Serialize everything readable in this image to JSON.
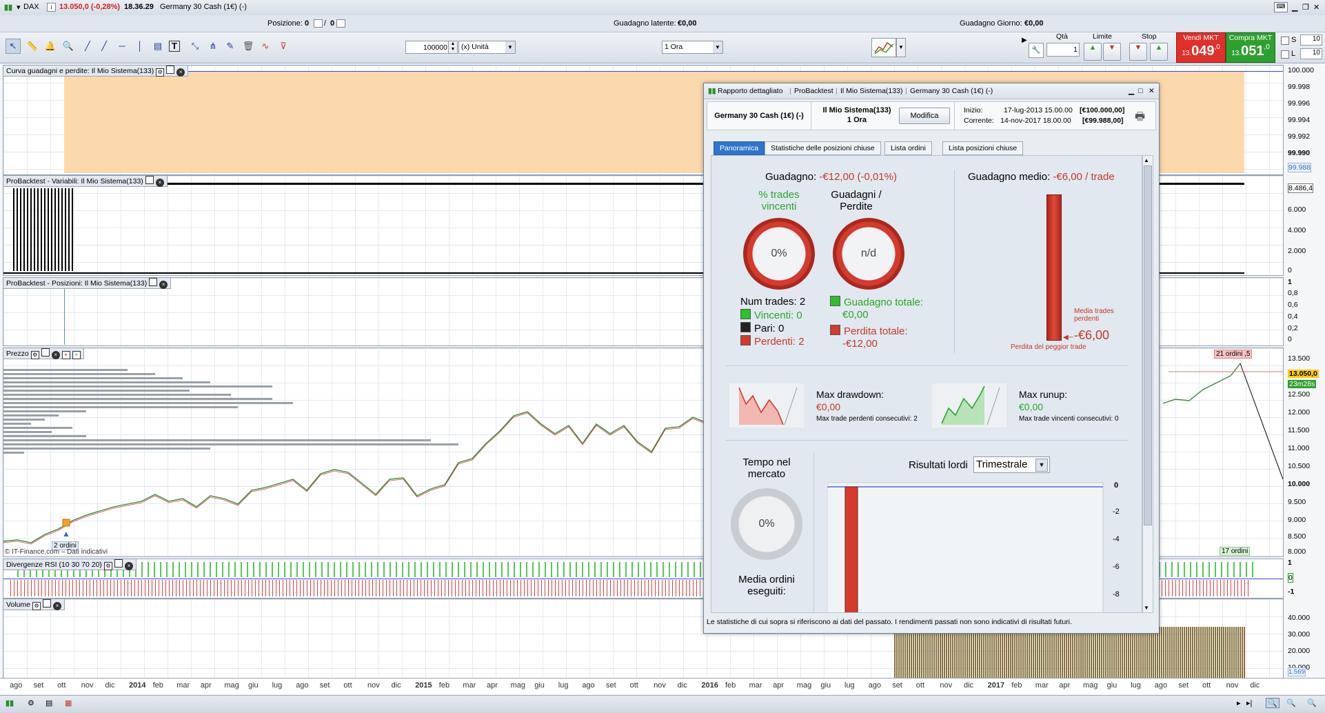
{
  "topbar": {
    "symbol": "DAX",
    "quote": "13.050,0 (-0,28%)",
    "time": "18.36.29",
    "instrument": "Germany 30 Cash (1€) (-)"
  },
  "infobar": {
    "posizione_label": "Posizione:",
    "posizione_value": "0",
    "posizione_sep": "/",
    "posizione_value2": "0",
    "latente_label": "Guadagno latente:",
    "latente_value": "€0,00",
    "giorno_label": "Guadagno Giorno:",
    "giorno_value": "€0,00"
  },
  "toolbar": {
    "qty_value": "100000",
    "unit_select": "(x) Unità",
    "timeframe_select": "1 Ora",
    "qta_label": "Qtà",
    "qta_value": "1",
    "limite_label": "Limite",
    "stop_label": "Stop",
    "vendi_label": "Vendi MKT",
    "vendi_small": "13.",
    "vendi_big": "049",
    "vendi_dec": ",0",
    "compra_label": "Compra MKT",
    "compra_small": "13.",
    "compra_big": "051",
    "compra_dec": ",0",
    "s_label": "S",
    "s_value": "10",
    "l_label": "L",
    "l_value": "10"
  },
  "panels": {
    "equity": "Curva guadagni e perdite: Il Mio Sistema(133)",
    "variabili": "ProBacktest - Variabili: Il Mio Sistema(133)",
    "posizioni": "ProBacktest - Posizioni: Il Mio Sistema(133)",
    "prezzo": "Prezzo",
    "rsi": "Divergenze RSI (10 30 70 20)",
    "volume": "Volume"
  },
  "axes": {
    "equity": [
      "100.000",
      "99.998",
      "99.996",
      "99.994",
      "99.992",
      "99.990",
      "99.988"
    ],
    "variabili": [
      "8.486,4",
      "6.000",
      "4.000",
      "2.000",
      "0"
    ],
    "posizioni": [
      "1",
      "0,8",
      "0,6",
      "0,4",
      "0,2",
      "0"
    ],
    "prezzo": [
      "13.500",
      "13.050,0",
      "23m28s",
      "12.500",
      "12.000",
      "11.500",
      "11.000",
      "10.500",
      "10.000",
      "9.500",
      "9.000",
      "8.500",
      "8.000"
    ],
    "rsi": [
      "1",
      "0",
      "-1"
    ],
    "volume": [
      "40.000",
      "30.000",
      "20.000",
      "10.000",
      "1.569"
    ]
  },
  "chart_labels": {
    "copyright": "© IT-Finance.com – Dati indicativi",
    "ordini_left": "2 ordini",
    "ordini_top": "21 ordini ,5",
    "ordini_right": "17 ordini"
  },
  "timeline": [
    "ago",
    "set",
    "ott",
    "nov",
    "dic",
    "2014",
    "feb",
    "mar",
    "apr",
    "mag",
    "giu",
    "lug",
    "ago",
    "set",
    "ott",
    "nov",
    "dic",
    "2015",
    "feb",
    "mar",
    "apr",
    "mag",
    "giu",
    "lug",
    "ago",
    "set",
    "ott",
    "nov",
    "dic",
    "2016",
    "feb",
    "mar",
    "apr",
    "mag",
    "giu",
    "lug",
    "ago",
    "set",
    "ott",
    "nov",
    "dic",
    "2017",
    "feb",
    "mar",
    "apr",
    "mag",
    "giu",
    "lug",
    "ago",
    "set",
    "ott",
    "nov",
    "dic"
  ],
  "dialog": {
    "title_parts": [
      "Rapporto dettagliato",
      "ProBacktest",
      "Il Mio Sistema(133)",
      "Germany 30 Cash (1€) (-)"
    ],
    "instrument": "Germany 30 Cash (1€) (-)",
    "system": "Il Mio Sistema(133)",
    "period": "1 Ora",
    "modifica": "Modifica",
    "inizio_label": "Inizio:",
    "inizio_date": "17-lug-2013 15.00.00",
    "inizio_value": "[€100.000,00]",
    "corrente_label": "Corrente:",
    "corrente_date": "14-nov-2017 18.00.00",
    "corrente_value": "[€99.988,00]",
    "tabs": [
      "Panoramica",
      "Statistiche delle posizioni chiuse",
      "Lista ordini",
      "Lista posizioni chiuse"
    ],
    "guadagno_label": "Guadagno:",
    "guadagno_value": "-€12,00 (-0,01%)",
    "trades_title": "% trades vincenti",
    "trades_value": "0%",
    "gp_title": "Guadagni / Perdite",
    "gp_value": "n/d",
    "num_trades": "Num trades: 2",
    "vincenti": "Vincenti: 0",
    "pari": "Pari: 0",
    "perdenti": "Perdenti: 2",
    "guad_tot_label": "Guadagno totale:",
    "guad_tot_value": "€0,00",
    "perd_tot_label": "Perdita totale:",
    "perd_tot_value": "-€12,00",
    "medio_label": "Guadagno medio:",
    "medio_value": "-€6,00 / trade",
    "media_trades": "Media trades perdenti",
    "media_value": "-€6,00",
    "peggior": "Perdita del peggior trade",
    "drawdown_label": "Max drawdown:",
    "drawdown_value": "€0,00",
    "drawdown_sub": "Max trade perdenti consecutivi:",
    "drawdown_sub_value": "2",
    "runup_label": "Max runup:",
    "runup_value": "€0,00",
    "runup_sub": "Max trade vincenti consecutivi:",
    "runup_sub_value": "0",
    "tempo_label": "Tempo nel mercato",
    "tempo_value": "0%",
    "media_ordini": "Media ordini eseguiti:",
    "risultati_label": "Risultati lordi",
    "risultati_select": "Trimestrale",
    "risultati_axis": [
      "0",
      "-2",
      "-4",
      "-6",
      "-8"
    ],
    "footer": "Le statistiche di cui sopra si riferiscono ai dati del passato. I rendimenti passati non sono indicativi di risultati futuri."
  },
  "colors": {
    "accent": "#2f75c9",
    "loss": "#d43a2e",
    "gain": "#2aa52a",
    "sell": "#e0302a",
    "buy": "#2ea02e"
  }
}
